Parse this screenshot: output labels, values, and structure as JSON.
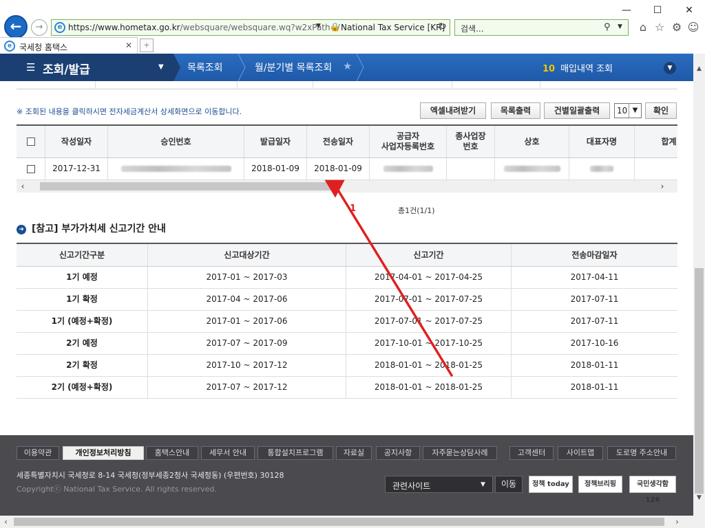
{
  "browser": {
    "url_host": "https://www.hometax.go.kr",
    "url_path": "/websquare/websquare.wq?w2xPath=/",
    "cert_label": "National Tax Service [KR]",
    "search_placeholder": "검색...",
    "tab_title": "국세청 홈택스",
    "win_min": "—",
    "win_max": "☐",
    "win_close": "✕"
  },
  "sitenav": {
    "menu_label": "조회/발급",
    "crumb1": "목록조회",
    "crumb2": "월/분기별 목록조회",
    "right_num": "10",
    "right_label": "매입내역 조회"
  },
  "toolbar": {
    "notice": "※ 조회된 내용을 클릭하시면 전자세금계산서 상세화면으로 이동합니다.",
    "excel_btn": "엑셀내려받기",
    "print_btn": "목록출력",
    "bulk_print_btn": "건별일괄출력",
    "page_size": "10",
    "confirm_btn": "확인"
  },
  "invoice_table": {
    "headers": [
      "작성일자",
      "승인번호",
      "발급일자",
      "전송일자",
      "공급자\n사업자등록번호",
      "종사업장\n번호",
      "상호",
      "대표자명",
      "합계"
    ],
    "row": {
      "write_date": "2017-12-31",
      "issue_date": "2018-01-09",
      "send_date": "2018-01-09"
    },
    "count": "총1건(1/1)"
  },
  "reference": {
    "title": "[참고] 부가가치세 신고기간 안내",
    "headers": [
      "신고기간구분",
      "신고대상기간",
      "신고기간",
      "전송마감일자"
    ],
    "rows": [
      [
        "1기 예정",
        "2017-01 ~ 2017-03",
        "2017-04-01 ~ 2017-04-25",
        "2017-04-11"
      ],
      [
        "1기 확정",
        "2017-04 ~ 2017-06",
        "2017-07-01 ~ 2017-07-25",
        "2017-07-11"
      ],
      [
        "1기 (예정+확정)",
        "2017-01 ~ 2017-06",
        "2017-07-01 ~ 2017-07-25",
        "2017-07-11"
      ],
      [
        "2기 예정",
        "2017-07 ~ 2017-09",
        "2017-10-01 ~ 2017-10-25",
        "2017-10-16"
      ],
      [
        "2기 확정",
        "2017-10 ~ 2017-12",
        "2018-01-01 ~ 2018-01-25",
        "2018-01-11"
      ],
      [
        "2기 (예정+확정)",
        "2017-07 ~ 2017-12",
        "2018-01-01 ~ 2018-01-25",
        "2018-01-11"
      ]
    ]
  },
  "annotation": {
    "number": "1",
    "color": "#e02020"
  },
  "footer": {
    "links": [
      "이용약관",
      "개인정보처리방침",
      "홈택스안내",
      "세무서 안내",
      "통합설치프로그램",
      "자료실",
      "공지사항",
      "자주묻는상담사례",
      "고객센터",
      "사이트맵",
      "도로명 주소안내"
    ],
    "address": "세종특별자치시 국세청로 8-14 국세청(정부세종2청사 국세청동) (우편번호) 30128",
    "copyright": "Copyrightⓒ National Tax Service. All rights reserved.",
    "related_label": "관련사이트",
    "go_label": "이동",
    "banner1": "정책 today",
    "banner2": "정책브리핑",
    "banner3": "국민생각함 126"
  }
}
